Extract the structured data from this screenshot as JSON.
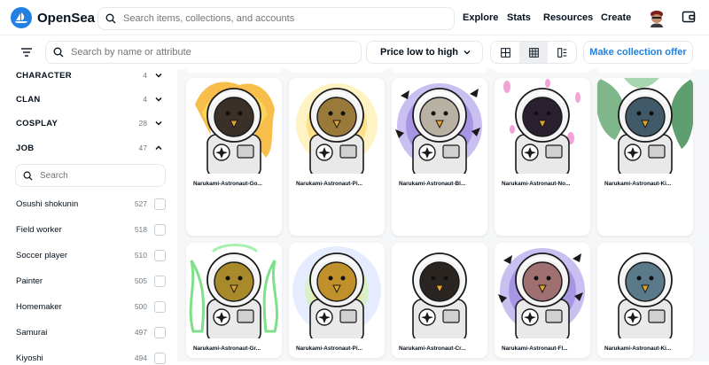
{
  "header": {
    "brand": "OpenSea",
    "search_placeholder": "Search items, collections, and accounts",
    "nav": [
      "Explore",
      "Stats",
      "Resources",
      "Create"
    ]
  },
  "toolbar": {
    "search_placeholder": "Search by name or attribute",
    "sort_label": "Price low to high",
    "offer_label": "Make collection offer"
  },
  "sidebar": {
    "traits": [
      {
        "name": "CHARACTER",
        "count": "4"
      },
      {
        "name": "CLAN",
        "count": "4"
      },
      {
        "name": "COSPLAY",
        "count": "28"
      },
      {
        "name": "JOB",
        "count": "47"
      }
    ],
    "search_placeholder": "Search",
    "options": [
      {
        "name": "Osushi shokunin",
        "count": "527"
      },
      {
        "name": "Field worker",
        "count": "518"
      },
      {
        "name": "Soccer player",
        "count": "510"
      },
      {
        "name": "Painter",
        "count": "505"
      },
      {
        "name": "Homemaker",
        "count": "500"
      },
      {
        "name": "Samurai",
        "count": "497"
      },
      {
        "name": "Kiyoshi",
        "count": "494"
      }
    ]
  },
  "items": [
    {
      "name": "Narukami-Astronaut-Go...",
      "bg": "fire",
      "face": "#3a3028"
    },
    {
      "name": "Narukami-Astronaut-Pi...",
      "bg": "glow",
      "face": "#9a7a3a"
    },
    {
      "name": "Narukami-Astronaut-Bl...",
      "bg": "purple",
      "face": "#b8b0a0"
    },
    {
      "name": "Narukami-Astronaut-No...",
      "bg": "petals",
      "face": "#2a2030"
    },
    {
      "name": "Narukami-Astronaut-Ki...",
      "bg": "leaves",
      "face": "#405a6a"
    },
    {
      "name": "Narukami-Astronaut-Gr...",
      "bg": "greenfire",
      "face": "#a88a2a"
    },
    {
      "name": "Narukami-Astronaut-Pi...",
      "bg": "rays",
      "face": "#c0902a"
    },
    {
      "name": "Narukami-Astronaut-Cr...",
      "bg": "plain",
      "face": "#2a2520"
    },
    {
      "name": "Narukami-Astronaut-Fl...",
      "bg": "purple",
      "face": "#a07070"
    },
    {
      "name": "Narukami-Astronaut-Ki...",
      "bg": "plain",
      "face": "#5a7a8a"
    }
  ],
  "colors": {
    "accent": "#2081e2",
    "text": "#04111d",
    "muted": "#707a83",
    "border": "#e5e8eb"
  }
}
